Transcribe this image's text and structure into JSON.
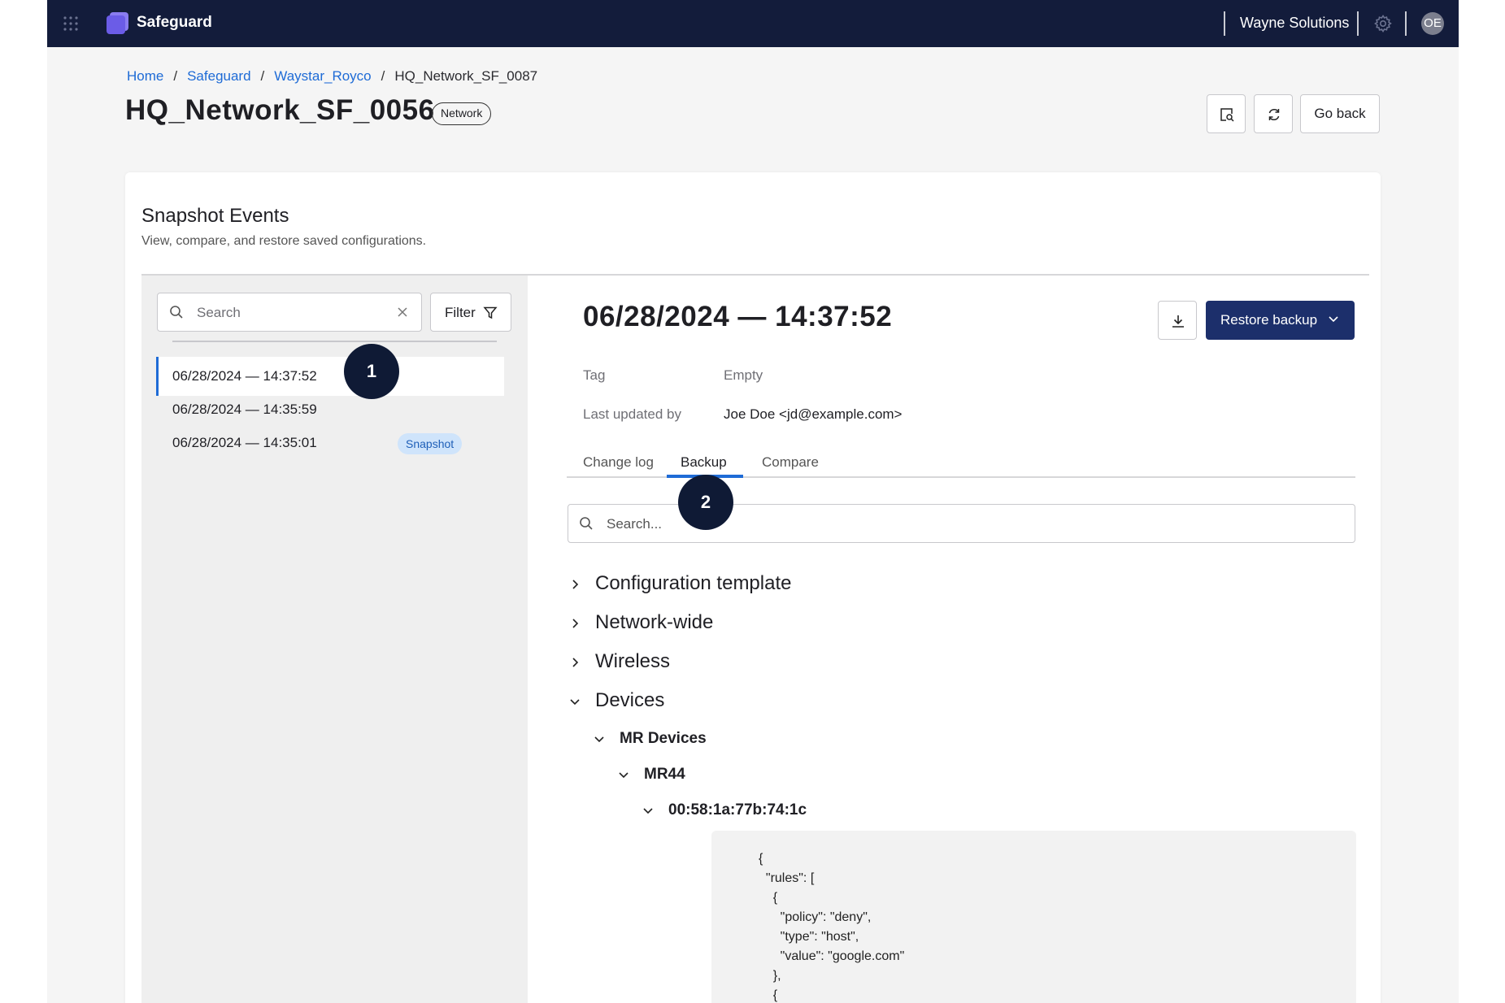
{
  "topbar": {
    "brand": "Safeguard",
    "org": "Wayne Solutions",
    "avatar_initials": "OE",
    "icons": [
      "apps-grid-icon",
      "gear-icon"
    ]
  },
  "breadcrumb": {
    "items": [
      "Home",
      "Safeguard",
      "Waystar_Royco"
    ],
    "current": "HQ_Network_SF_0087"
  },
  "header": {
    "title": "HQ_Network_SF_0056",
    "badge": "Network",
    "go_back": "Go back"
  },
  "card": {
    "title": "Snapshot Events",
    "subtitle": "View, compare, and restore saved configurations."
  },
  "sidebar": {
    "search_placeholder": "Search",
    "filter_label": "Filter",
    "events": [
      {
        "label": "06/28/2024 — 14:37:52",
        "selected": true
      },
      {
        "label": "06/28/2024 — 14:35:59"
      },
      {
        "label": "06/28/2024 — 14:35:01",
        "badge": "Snapshot"
      }
    ]
  },
  "markers": [
    "1",
    "2"
  ],
  "detail": {
    "title": "06/28/2024 — 14:37:52",
    "restore_label": "Restore backup",
    "tag_label": "Tag",
    "tag_value": "Empty",
    "updated_label": "Last updated by",
    "updated_value": "Joe Doe <jd@example.com>",
    "tabs": [
      "Change log",
      "Backup",
      "Compare"
    ],
    "active_tab": "Backup",
    "search_placeholder": "Search...",
    "tree": {
      "sections": [
        "Configuration template",
        "Network-wide",
        "Wireless",
        "Devices"
      ],
      "mr_devices": "MR Devices",
      "model": "MR44",
      "mac": "00:58:1a:77b:74:1c"
    },
    "code_lines": [
      "{",
      "  \"rules\": [",
      "    {",
      "      \"policy\": \"deny\",",
      "      \"type\": \"host\",",
      "      \"value\": \"google.com\"",
      "    },",
      "    {"
    ]
  },
  "colors": {
    "topbar": "#131c3b",
    "primary": "#1c2f6b",
    "link": "#1e6bd6",
    "brand_logo": "#6b5ce7"
  }
}
